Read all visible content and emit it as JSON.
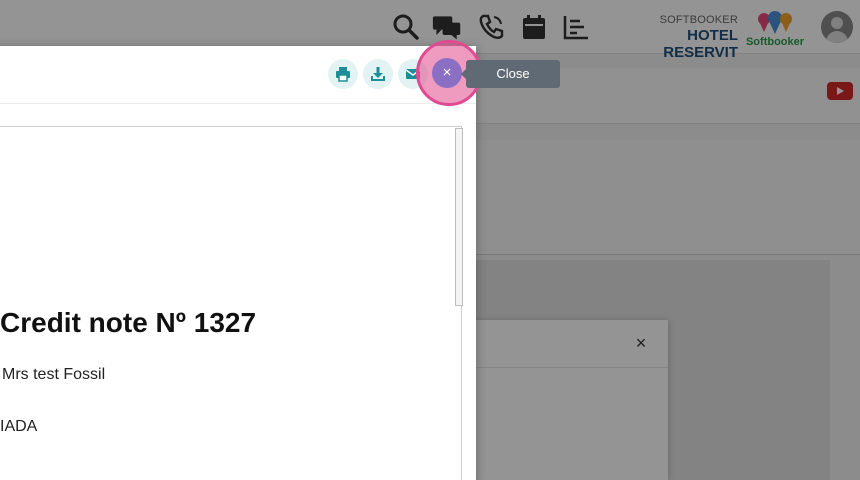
{
  "header": {
    "brand_sub": "SOFTBOOKER",
    "brand_name": "HOTEL RESERVIT",
    "logo_text": "Softbooker",
    "icons": [
      "search-icon",
      "chat-icon",
      "phone-icon",
      "calendar-icon",
      "bar-chart-icon",
      "avatar"
    ]
  },
  "modal": {
    "actions": [
      "print-icon",
      "download-icon",
      "email-icon",
      "close-icon"
    ],
    "close_symbol": "×",
    "close_tooltip": "Close"
  },
  "document": {
    "title": "Credit note Nº 1327",
    "line1": "Mrs test Fossil",
    "line2": "IADA"
  },
  "background_dialog": {
    "close_symbol": "×"
  },
  "colors": {
    "accent_teal": "#e3f2f3",
    "icon_teal": "#1e8f96",
    "highlight_pink": "#e04a90",
    "close_button": "#8b6fc4",
    "brand_blue": "#1f4f7a",
    "tooltip_bg": "#606a74"
  }
}
